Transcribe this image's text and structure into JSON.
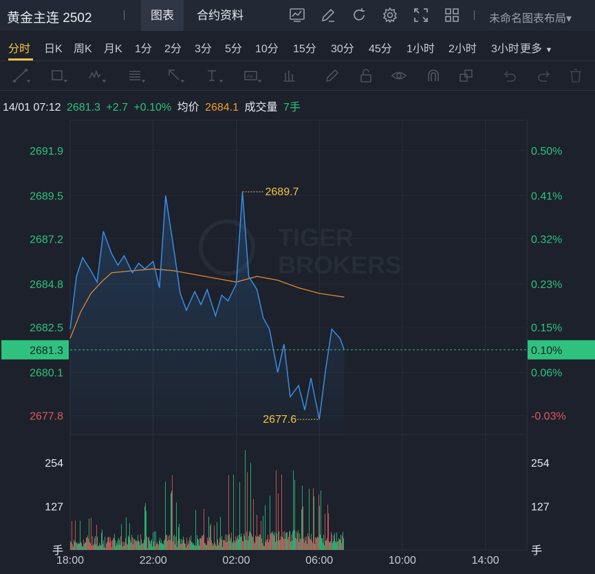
{
  "header": {
    "title": "黄金主连 2502",
    "tabs": [
      {
        "label": "图表",
        "active": true
      },
      {
        "label": "合约资料",
        "active": false
      }
    ],
    "icons": [
      "indicator-chart-icon",
      "pencil-icon",
      "refresh-icon",
      "gear-icon",
      "fullscreen-icon",
      "grid-layout-icon"
    ],
    "layout_label": "未命名图表布局▾"
  },
  "periods": {
    "items": [
      "分时",
      "日K",
      "周K",
      "月K",
      "1分",
      "2分",
      "3分",
      "5分",
      "10分",
      "15分",
      "30分",
      "45分",
      "1小时",
      "2小时",
      "3小时"
    ],
    "active": "分时",
    "more_label": "更多"
  },
  "toolbar": {
    "icons": [
      "trend-line-icon",
      "rectangle-icon",
      "wave-pattern-icon",
      "fibonacci-icon",
      "arrow-icon",
      "text-cursor-icon",
      "text-box-icon",
      "bar-tool-icon",
      "brush-icon",
      "lock-icon",
      "eye-icon",
      "magnet-icon",
      "layers-icon",
      "undo-icon",
      "redo-icon",
      "trash-icon"
    ]
  },
  "info_line": {
    "time": "14/01 07:12",
    "price": "2681.3",
    "change": "+2.7",
    "change_pct": "+0.10%",
    "avg_label": "均价",
    "avg_value": "2684.1",
    "vol_label": "成交量",
    "vol_value": "7手"
  },
  "colors": {
    "up": "#2ec27e",
    "down": "#e05a5a",
    "price_line": "#3a8ee6",
    "avg_line": "#e08a3a",
    "highlight": "#f5c542"
  },
  "watermark": {
    "line1": "TIGER",
    "line2": "BROKERS"
  },
  "chart_data": {
    "type": "line",
    "price_ticks": [
      "2691.9",
      "2689.5",
      "2687.2",
      "2684.8",
      "2682.5",
      "2680.1",
      "2677.8"
    ],
    "pct_ticks": [
      "0.50%",
      "0.41%",
      "0.32%",
      "0.23%",
      "0.15%",
      "0.06%",
      "-0.03%"
    ],
    "current_price_label": "2681.3",
    "current_pct_label": "0.10%",
    "high_label": "2689.7",
    "low_label": "2677.6",
    "time_ticks": [
      "18:00",
      "22:00",
      "02:00",
      "06:00",
      "10:00",
      "14:00"
    ],
    "volume_ticks": [
      "254",
      "127",
      "手"
    ],
    "volume_ticks_right": [
      "254",
      "127",
      "手"
    ],
    "price_range": [
      2676.8,
      2693.5
    ],
    "current_price": 2681.3,
    "high": 2689.7,
    "low": 2677.6,
    "series": [
      {
        "name": "价格",
        "x": [
          0,
          0.3,
          0.6,
          1.0,
          1.3,
          1.6,
          2.0,
          2.3,
          2.6,
          3.0,
          3.3,
          3.6,
          4.0,
          4.3,
          4.6,
          5.0,
          5.3,
          5.6,
          6.0,
          6.3,
          6.6,
          7.0,
          7.3,
          7.6,
          8.0,
          8.3,
          8.6,
          9.0,
          9.3,
          9.6,
          10.0,
          10.3,
          10.6,
          11.0,
          11.3,
          11.6,
          12.0,
          12.3,
          12.6,
          13.0,
          13.2
        ],
        "y": [
          2682.4,
          2685.2,
          2686.2,
          2685.5,
          2684.9,
          2687.6,
          2686.4,
          2685.8,
          2686.3,
          2685.4,
          2685.9,
          2685.6,
          2686.0,
          2684.6,
          2689.5,
          2686.6,
          2684.3,
          2683.4,
          2684.4,
          2683.7,
          2684.5,
          2683.1,
          2684.2,
          2683.9,
          2684.8,
          2689.7,
          2685.2,
          2684.5,
          2683.0,
          2682.4,
          2680.1,
          2681.6,
          2678.8,
          2679.4,
          2678.1,
          2679.8,
          2677.6,
          2680.2,
          2682.4,
          2681.9,
          2681.3
        ]
      },
      {
        "name": "均价",
        "x": [
          0,
          0.5,
          1.0,
          1.5,
          2.0,
          3.0,
          4.0,
          5.0,
          6.0,
          7.0,
          8.0,
          9.0,
          10.0,
          11.0,
          12.0,
          12.6,
          13.2
        ],
        "y": [
          2681.9,
          2683.3,
          2684.3,
          2684.9,
          2685.4,
          2685.5,
          2685.6,
          2685.5,
          2685.3,
          2685.1,
          2684.9,
          2685.2,
          2685.0,
          2684.6,
          2684.3,
          2684.2,
          2684.1
        ]
      }
    ],
    "volume_range": [
      0,
      320
    ],
    "volume": {
      "x_start": 0,
      "x_end": 13.2,
      "peak_values": [
        80,
        120,
        60,
        110,
        150,
        70,
        200,
        90,
        130,
        100,
        220,
        280,
        140,
        260,
        300,
        180,
        170,
        240
      ]
    }
  }
}
